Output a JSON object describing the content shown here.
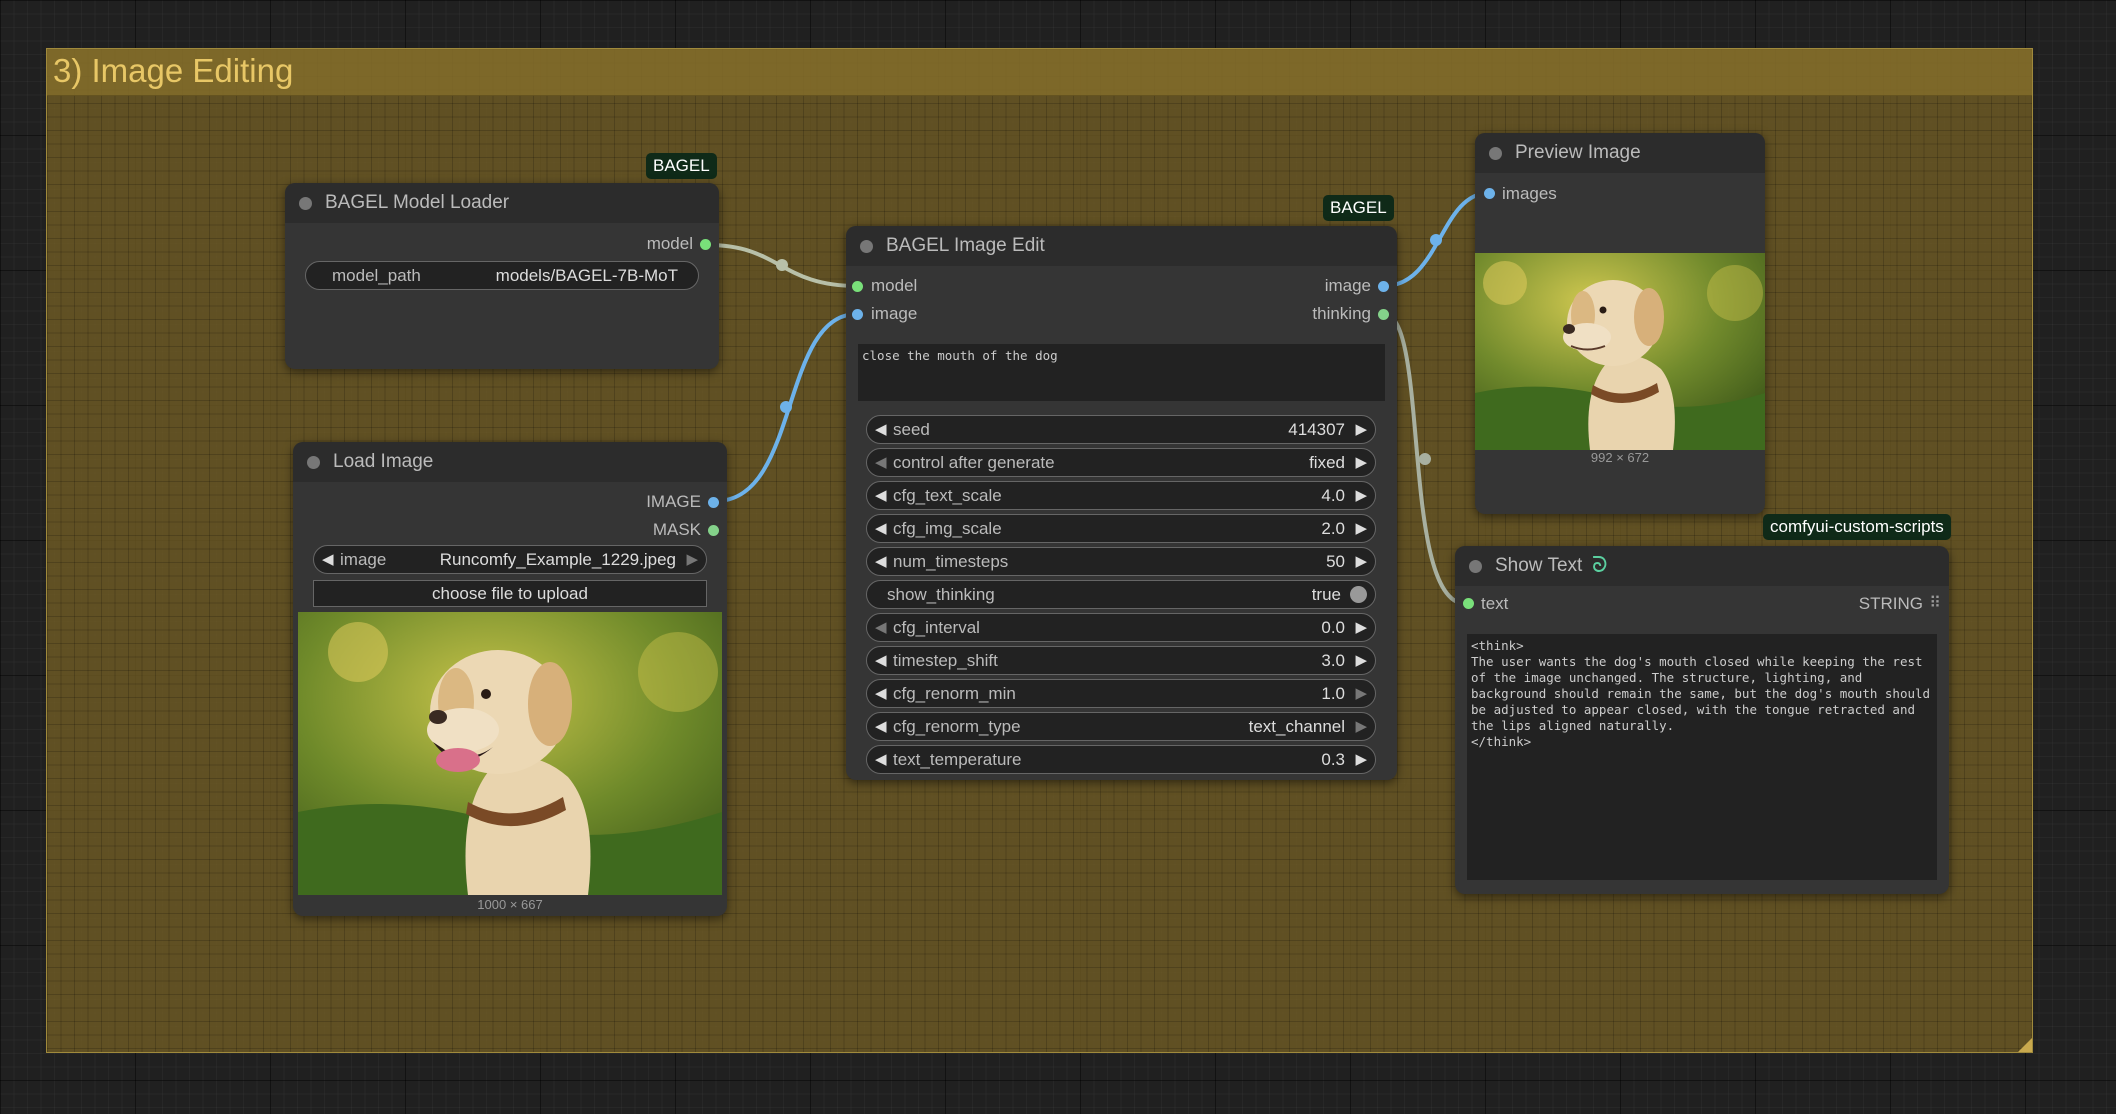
{
  "group": {
    "title": "3) Image Editing"
  },
  "nodes": {
    "model_loader": {
      "title": "BAGEL Model Loader",
      "badge": "BAGEL",
      "outputs": {
        "model": "model"
      },
      "widgets": {
        "model_path_label": "model_path",
        "model_path_value": "models/BAGEL-7B-MoT"
      }
    },
    "load_image": {
      "title": "Load Image",
      "outputs": {
        "image": "IMAGE",
        "mask": "MASK"
      },
      "widgets": {
        "image_label": "image",
        "image_value": "Runcomfy_Example_1229.jpeg",
        "upload_label": "choose file to upload"
      },
      "image_size": "1000 × 667"
    },
    "image_edit": {
      "title": "BAGEL Image Edit",
      "badge": "BAGEL",
      "inputs": {
        "model": "model",
        "image": "image"
      },
      "outputs": {
        "image": "image",
        "thinking": "thinking"
      },
      "prompt": "close the mouth of the dog",
      "widgets": [
        {
          "label": "seed",
          "value": "414307"
        },
        {
          "label": "control after generate",
          "value": "fixed"
        },
        {
          "label": "cfg_text_scale",
          "value": "4.0"
        },
        {
          "label": "cfg_img_scale",
          "value": "2.0"
        },
        {
          "label": "num_timesteps",
          "value": "50"
        },
        {
          "label": "show_thinking",
          "value": "true"
        },
        {
          "label": "cfg_interval",
          "value": "0.0"
        },
        {
          "label": "timestep_shift",
          "value": "3.0"
        },
        {
          "label": "cfg_renorm_min",
          "value": "1.0"
        },
        {
          "label": "cfg_renorm_type",
          "value": "text_channel"
        },
        {
          "label": "text_temperature",
          "value": "0.3"
        }
      ]
    },
    "preview_image": {
      "title": "Preview Image",
      "inputs": {
        "images": "images"
      },
      "image_size": "992 × 672"
    },
    "show_text": {
      "title": "Show Text",
      "badge": "comfyui-custom-scripts",
      "inputs": {
        "text": "text"
      },
      "output_type": "STRING",
      "content": "<think>\nThe user wants the dog's mouth closed while keeping the rest\nof the image unchanged. The structure, lighting, and\nbackground should remain the same, but the dog's mouth should\nbe adjusted to appear closed, with the tongue retracted and\nthe lips aligned naturally.\n</think>"
    }
  },
  "colors": {
    "group_title": "#e8c766",
    "model_link": "#b8c0a8",
    "image_link": "#6db2ea",
    "string_link": "#a8b0a0"
  }
}
